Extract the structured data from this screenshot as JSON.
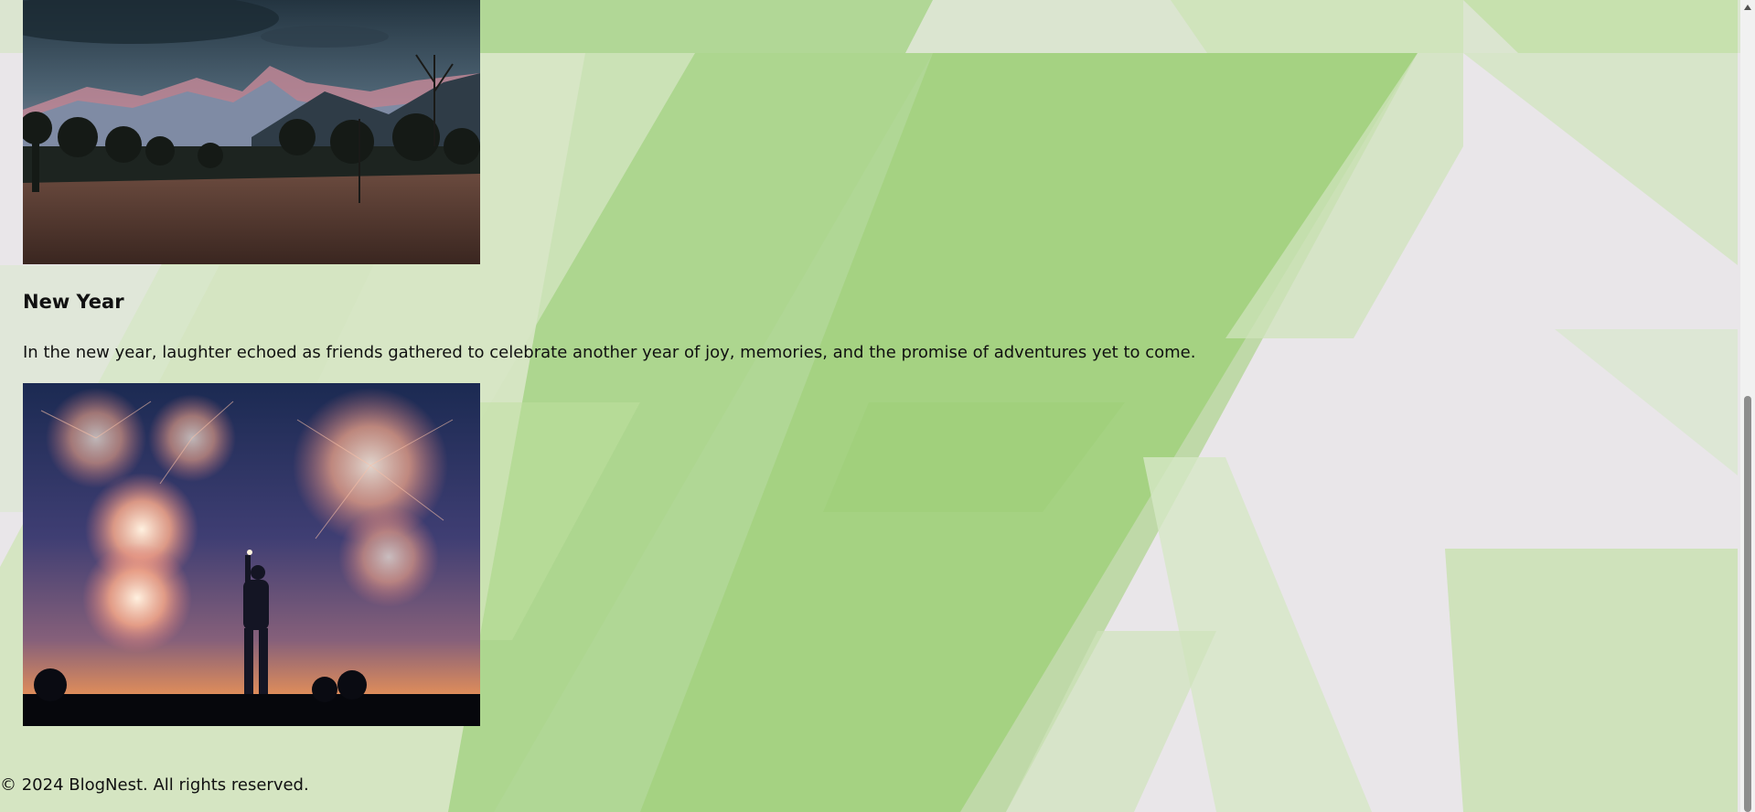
{
  "posts": [
    {
      "title": "New Year",
      "body": "In the new year, laughter echoed as friends gathered to celebrate another year of joy, memories, and the promise of adventures yet to come."
    }
  ],
  "footer": {
    "copyright": "© 2024 BlogNest. All rights reserved."
  },
  "icons": {
    "scroll_up": "scroll-up-arrow-icon"
  },
  "colors": {
    "background": "#e9e6e9",
    "accent_green": "#9ccd73"
  }
}
